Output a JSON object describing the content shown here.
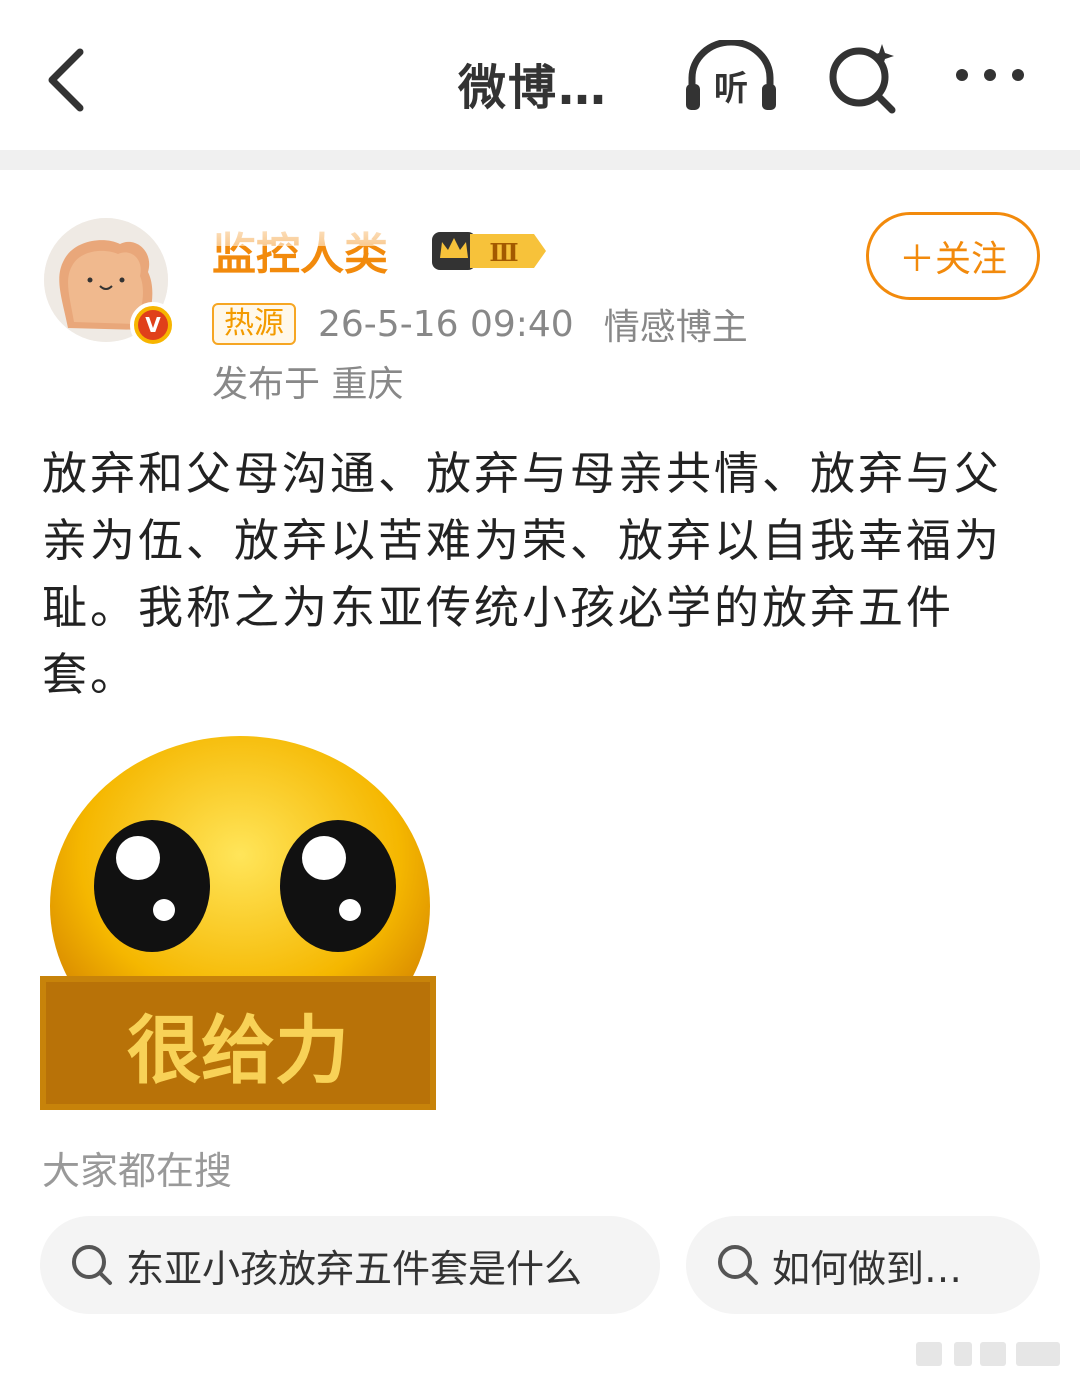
{
  "header": {
    "title": "微博…",
    "listen_label": "听"
  },
  "post": {
    "author": "监控人类",
    "level_badge": "Ⅲ",
    "follow_label": "＋关注",
    "source_tag": "热源",
    "time": "26-5-16 09:40",
    "role": "情感博主",
    "location": "发布于 重庆",
    "text": "放弃和父母沟通、放弃与母亲共情、放弃与父亲为伍、放弃以苦难为荣、放弃以自我幸福为耻。我称之为东亚传统小孩必学的放弃五件套。",
    "sticker_text": "很给力"
  },
  "search_section": {
    "title": "大家都在搜",
    "chips": [
      {
        "label": "东亚小孩放弃五件套是什么"
      },
      {
        "label": "如何做到…"
      }
    ]
  },
  "colors": {
    "accent": "#f28a0c",
    "tag_border": "#f6a623",
    "meta_gray": "#888888",
    "chip_bg": "#f4f4f4"
  },
  "icons": [
    "back-arrow-icon",
    "listen-headphone-icon",
    "search-sparkle-icon",
    "more-dots-icon",
    "search-icon"
  ]
}
